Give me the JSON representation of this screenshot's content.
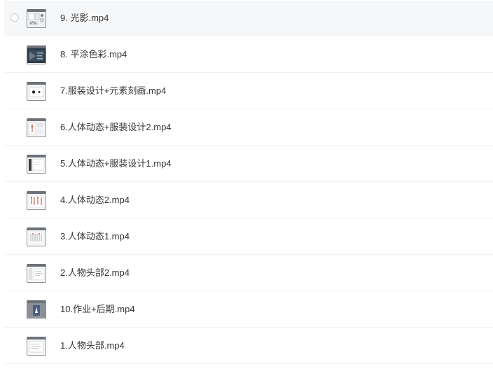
{
  "files": [
    {
      "name": "9. 光影.mp4",
      "thumb_icon": "video-thumbnail-icon"
    },
    {
      "name": "8. 平涂色彩.mp4",
      "thumb_icon": "video-thumbnail-icon"
    },
    {
      "name": "7.服装设计+元素刻画.mp4",
      "thumb_icon": "video-thumbnail-icon"
    },
    {
      "name": "6.人体动态+服装设计2.mp4",
      "thumb_icon": "video-thumbnail-icon"
    },
    {
      "name": "5.人体动态+服装设计1.mp4",
      "thumb_icon": "video-thumbnail-icon"
    },
    {
      "name": "4.人体动态2.mp4",
      "thumb_icon": "video-thumbnail-icon"
    },
    {
      "name": "3.人体动态1.mp4",
      "thumb_icon": "video-thumbnail-icon"
    },
    {
      "name": "2.人物头部2.mp4",
      "thumb_icon": "video-thumbnail-icon"
    },
    {
      "name": "10.作业+后期.mp4",
      "thumb_icon": "video-thumbnail-icon"
    },
    {
      "name": "1.人物头部.mp4",
      "thumb_icon": "video-thumbnail-icon"
    }
  ],
  "colors": {
    "hover_row": "#f6f7f9",
    "divider": "#f1f2f4",
    "text": "#333333",
    "checkbox_border": "#c9cdd4"
  }
}
